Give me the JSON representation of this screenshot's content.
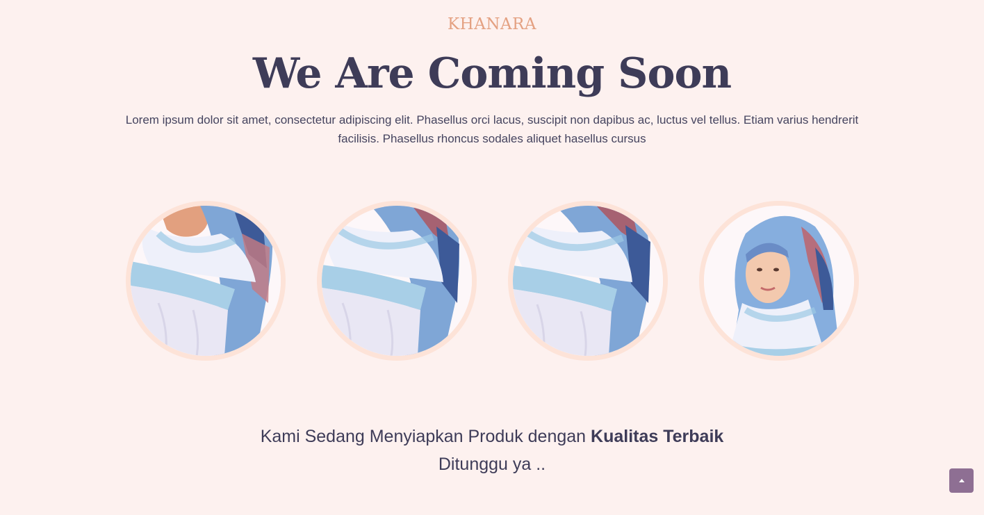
{
  "header": {
    "brand": "KHANARA",
    "headline": "We Are Coming Soon",
    "intro": "Lorem ipsum dolor sit amet, consectetur adipiscing elit. Phasellus orci lacus, suscipit non dapibus ac, luctus vel tellus. Etiam varius hendrerit facilisis. Phasellus rhoncus sodales aliquet hasellus cursus"
  },
  "gallery": {
    "items": [
      {
        "subject": "hijab-shoulder-photo"
      },
      {
        "subject": "hijab-shoulder-photo"
      },
      {
        "subject": "hijab-shoulder-photo"
      },
      {
        "subject": "hijab-model-portrait"
      }
    ]
  },
  "message": {
    "line1_prefix": "Kami Sedang Menyiapkan Produk dengan",
    "line1_bold": "Kualitas Terbaik",
    "line2": "Ditunggu ya .."
  },
  "scroll_top": {
    "icon": "chevron-up-icon"
  },
  "colors": {
    "background": "#fdf1ef",
    "brand": "#e4a182",
    "heading": "#3e3c58",
    "ring": "#fde3d8",
    "button": "#8e6f93"
  }
}
